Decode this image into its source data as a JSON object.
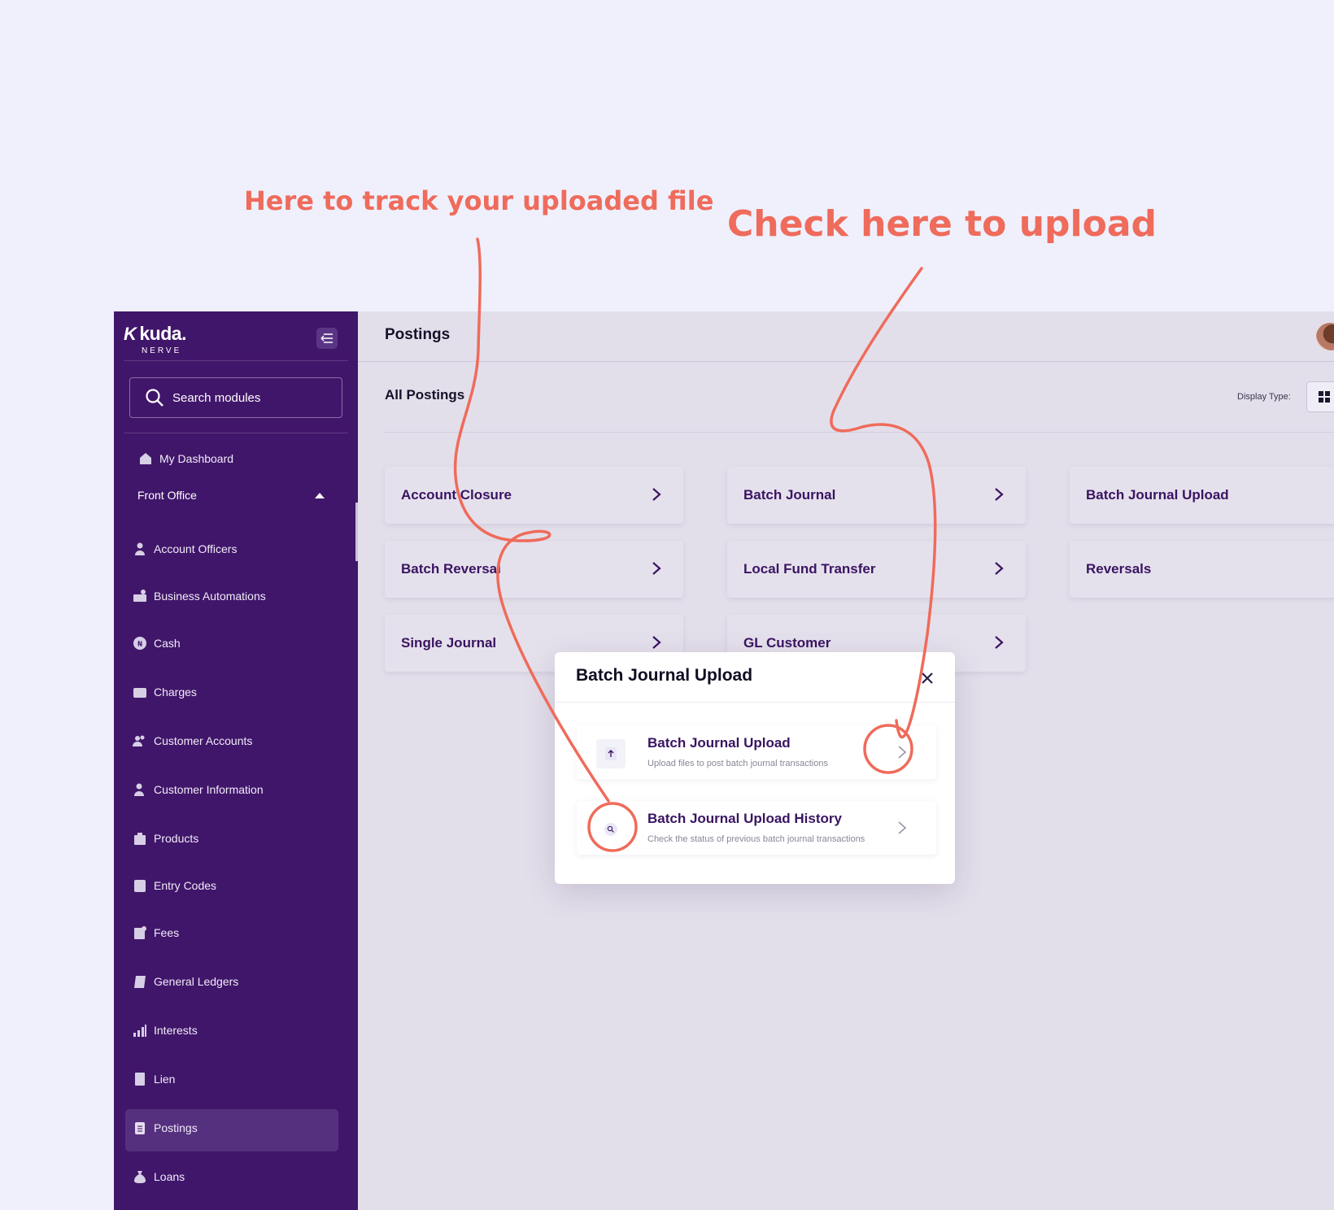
{
  "annotations": {
    "track": "Here to track your uploaded file",
    "upload": "Check here to upload"
  },
  "sidebar": {
    "brand": "kuda.",
    "brand_sub": "NERVE",
    "search_placeholder": "Search modules",
    "dashboard": "My Dashboard",
    "section": "Front Office",
    "items": [
      {
        "label": "Account Officers",
        "icon": "person-icon"
      },
      {
        "label": "Business Automations",
        "icon": "automation-icon"
      },
      {
        "label": "Cash",
        "icon": "naira-coin-icon"
      },
      {
        "label": "Charges",
        "icon": "wallet-icon"
      },
      {
        "label": "Customer Accounts",
        "icon": "users-icon"
      },
      {
        "label": "Customer Information",
        "icon": "user-info-icon"
      },
      {
        "label": "Products",
        "icon": "bag-icon"
      },
      {
        "label": "Entry Codes",
        "icon": "code-icon"
      },
      {
        "label": "Fees",
        "icon": "receipt-icon"
      },
      {
        "label": "General Ledgers",
        "icon": "ledger-icon"
      },
      {
        "label": "Interests",
        "icon": "chart-icon"
      },
      {
        "label": "Lien",
        "icon": "document-icon"
      },
      {
        "label": "Postings",
        "icon": "postings-icon"
      },
      {
        "label": "Loans",
        "icon": "money-bag-icon"
      }
    ],
    "active_item": "Postings"
  },
  "header": {
    "title": "Postings",
    "subtitle": "All Postings",
    "display_type_label": "Display Type:"
  },
  "cards": [
    {
      "label": "Account Closure"
    },
    {
      "label": "Batch Journal"
    },
    {
      "label": "Batch Journal Upload"
    },
    {
      "label": "Batch Reversal"
    },
    {
      "label": "Local Fund Transfer"
    },
    {
      "label": "Reversals"
    },
    {
      "label": "Single Journal"
    },
    {
      "label": "GL Customer"
    }
  ],
  "modal": {
    "title": "Batch Journal Upload",
    "options": [
      {
        "title": "Batch Journal Upload",
        "desc": "Upload files to post batch journal transactions",
        "icon": "upload-icon"
      },
      {
        "title": "Batch Journal Upload History",
        "desc": "Check the status of previous batch journal transactions",
        "icon": "search-icon"
      }
    ]
  },
  "colors": {
    "sidebar": "#40166a",
    "accent": "#3a1462",
    "annotation": "#ef6b5b",
    "background": "#eff0fc"
  }
}
